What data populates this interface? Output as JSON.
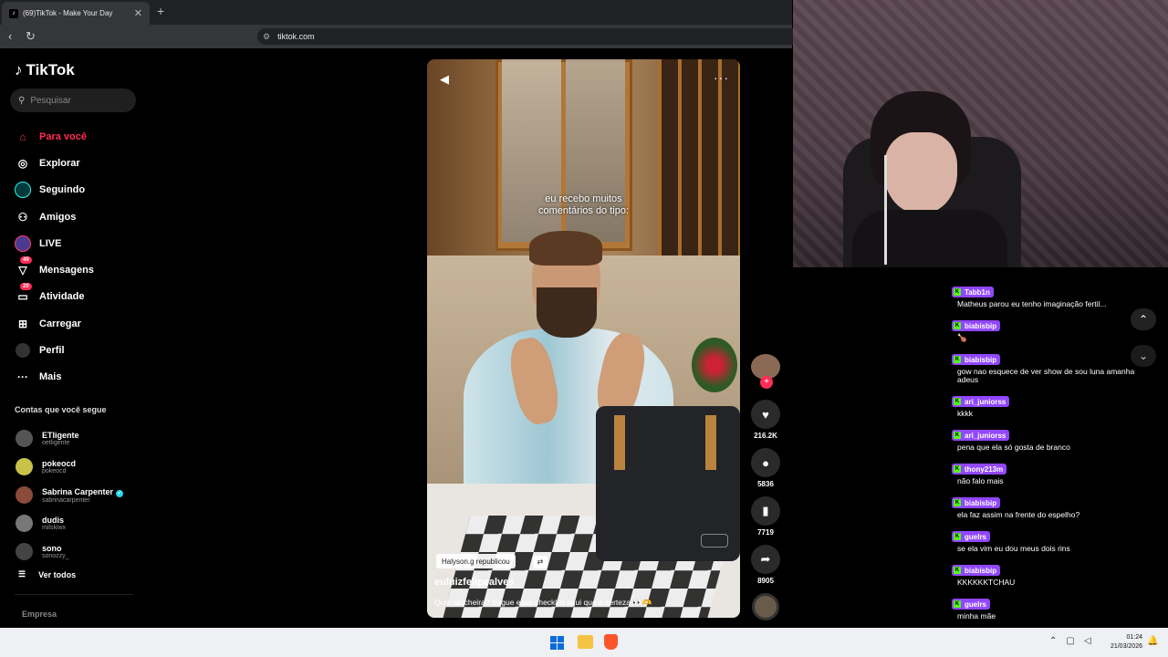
{
  "browser": {
    "tab_title": "(69)TikTok - Make Your Day",
    "tab_close": "✕",
    "new_tab": "+",
    "url": "tiktok.com"
  },
  "sidebar": {
    "logo": "TikTok",
    "search_placeholder": "Pesquisar",
    "nav": [
      {
        "label": "Para você",
        "icon": "home-icon",
        "active": true
      },
      {
        "label": "Explorar",
        "icon": "compass-icon"
      },
      {
        "label": "Seguindo",
        "icon": "following-icon"
      },
      {
        "label": "Amigos",
        "icon": "friends-icon"
      },
      {
        "label": "LIVE",
        "icon": "live-icon"
      },
      {
        "label": "Mensagens",
        "icon": "messages-icon",
        "badge": "49"
      },
      {
        "label": "Atividade",
        "icon": "activity-icon",
        "badge": "20"
      },
      {
        "label": "Carregar",
        "icon": "upload-icon"
      },
      {
        "label": "Perfil",
        "icon": "profile-icon"
      },
      {
        "label": "Mais",
        "icon": "more-icon"
      }
    ],
    "following_title": "Contas que você segue",
    "accounts": [
      {
        "name": "ETligente",
        "handle": "oetligente",
        "color": "#555"
      },
      {
        "name": "pokeocd",
        "handle": "pokeocd",
        "color": "#c9c24a"
      },
      {
        "name": "Sabrina Carpenter",
        "handle": "sabrinacarpenter",
        "color": "#8a4b3a",
        "verified": true
      },
      {
        "name": "dudis",
        "handle": "milskiwx",
        "color": "#777"
      },
      {
        "name": "sono",
        "handle": "sonozzy_",
        "color": "#444"
      }
    ],
    "see_all": "Ver todos",
    "company": "Empresa"
  },
  "video": {
    "caption": "eu recebo muitos\ncomentários do tipo:",
    "repost": "Halyson.g republicou",
    "author": "euluizfelipealves",
    "description": "Quer lancheira? Segue esse checklist aqui que é certeza 👀🫶"
  },
  "actions": {
    "likes": "216.2K",
    "comments": "5836",
    "saves": "7719",
    "shares": "8905"
  },
  "chat": [
    {
      "user": "Tabb1n",
      "text": "Matheus parou eu tenho imaginação fertil..."
    },
    {
      "user": "biabisbip",
      "text": "🍗"
    },
    {
      "user": "biabisbip",
      "text": "gow nao esquece de ver show de sou luna amanha adeus"
    },
    {
      "user": "ari_juniorss",
      "text": "kkkk"
    },
    {
      "user": "ari_juniorss",
      "text": "pena que ela só gosta de branco"
    },
    {
      "user": "thony213m",
      "text": "não falo mais"
    },
    {
      "user": "biabisbip",
      "text": "ela faz assim na frente do espelho?"
    },
    {
      "user": "guelrs",
      "text": "se ela vim eu dou meus dois rins"
    },
    {
      "user": "biabisbip",
      "text": "KKKKKKTCHAU"
    },
    {
      "user": "guelrs",
      "text": "minha mãe"
    }
  ],
  "taskbar": {
    "time": "01:24",
    "date": "21/03/2026"
  },
  "colors": {
    "accent": "#fe2c55",
    "chat_user": "#9147ff",
    "kick_green": "#53fc18"
  }
}
